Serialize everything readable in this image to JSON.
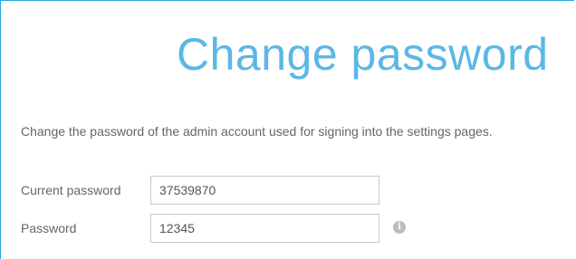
{
  "page": {
    "title": "Change password",
    "description": "Change the password of the admin account used for signing into the settings pages."
  },
  "form": {
    "current_password": {
      "label": "Current password",
      "value": "37539870"
    },
    "password": {
      "label": "Password",
      "value": "12345",
      "info_icon": "info-icon"
    }
  },
  "colors": {
    "accent": "#5bb7e5",
    "frame_border": "#2aa6e0",
    "text": "#666666",
    "input_border": "#c8c8c8",
    "info_icon": "#bdbdbd"
  }
}
